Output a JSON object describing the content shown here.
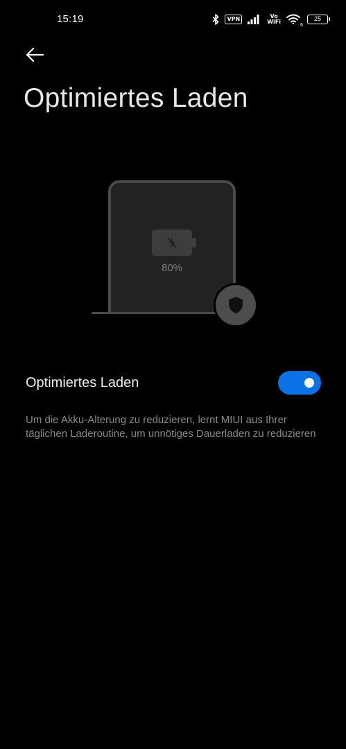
{
  "status_bar": {
    "time": "15:19",
    "vpn_label": "VPN",
    "vowifi_top": "Vo",
    "vowifi_bottom": "WiFi",
    "wifi_badge": "6",
    "battery_level": "25",
    "icons": [
      "bluetooth-icon",
      "vpn-icon",
      "signal-icon",
      "vowifi-icon",
      "wifi-icon",
      "battery-icon"
    ]
  },
  "header": {
    "back_icon": "arrow-left-icon",
    "title": "Optimiertes Laden"
  },
  "illustration": {
    "battery_percent": "80%",
    "battery_icon": "charging-disabled-icon",
    "badge_icon": "shield-icon"
  },
  "setting": {
    "label": "Optimiertes Laden",
    "enabled": true,
    "description": "Um die Akku-Alterung zu reduzieren, lernt MIUI aus Ihrer täglichen Laderoutine, um unnötiges Dauerladen zu reduzieren"
  },
  "colors": {
    "background": "#000000",
    "accent": "#0a72e6",
    "description_text": "#8a8a8a"
  }
}
